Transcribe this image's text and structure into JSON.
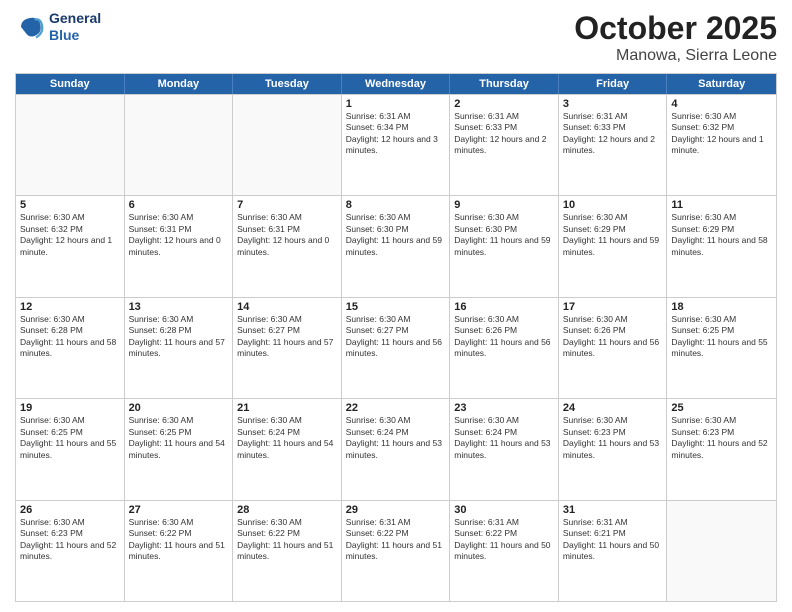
{
  "header": {
    "logo_line1": "General",
    "logo_line2": "Blue",
    "month": "October 2025",
    "location": "Manowa, Sierra Leone"
  },
  "weekdays": [
    "Sunday",
    "Monday",
    "Tuesday",
    "Wednesday",
    "Thursday",
    "Friday",
    "Saturday"
  ],
  "rows": [
    [
      {
        "day": "",
        "info": ""
      },
      {
        "day": "",
        "info": ""
      },
      {
        "day": "",
        "info": ""
      },
      {
        "day": "1",
        "info": "Sunrise: 6:31 AM\nSunset: 6:34 PM\nDaylight: 12 hours and 3 minutes."
      },
      {
        "day": "2",
        "info": "Sunrise: 6:31 AM\nSunset: 6:33 PM\nDaylight: 12 hours and 2 minutes."
      },
      {
        "day": "3",
        "info": "Sunrise: 6:31 AM\nSunset: 6:33 PM\nDaylight: 12 hours and 2 minutes."
      },
      {
        "day": "4",
        "info": "Sunrise: 6:30 AM\nSunset: 6:32 PM\nDaylight: 12 hours and 1 minute."
      }
    ],
    [
      {
        "day": "5",
        "info": "Sunrise: 6:30 AM\nSunset: 6:32 PM\nDaylight: 12 hours and 1 minute."
      },
      {
        "day": "6",
        "info": "Sunrise: 6:30 AM\nSunset: 6:31 PM\nDaylight: 12 hours and 0 minutes."
      },
      {
        "day": "7",
        "info": "Sunrise: 6:30 AM\nSunset: 6:31 PM\nDaylight: 12 hours and 0 minutes."
      },
      {
        "day": "8",
        "info": "Sunrise: 6:30 AM\nSunset: 6:30 PM\nDaylight: 11 hours and 59 minutes."
      },
      {
        "day": "9",
        "info": "Sunrise: 6:30 AM\nSunset: 6:30 PM\nDaylight: 11 hours and 59 minutes."
      },
      {
        "day": "10",
        "info": "Sunrise: 6:30 AM\nSunset: 6:29 PM\nDaylight: 11 hours and 59 minutes."
      },
      {
        "day": "11",
        "info": "Sunrise: 6:30 AM\nSunset: 6:29 PM\nDaylight: 11 hours and 58 minutes."
      }
    ],
    [
      {
        "day": "12",
        "info": "Sunrise: 6:30 AM\nSunset: 6:28 PM\nDaylight: 11 hours and 58 minutes."
      },
      {
        "day": "13",
        "info": "Sunrise: 6:30 AM\nSunset: 6:28 PM\nDaylight: 11 hours and 57 minutes."
      },
      {
        "day": "14",
        "info": "Sunrise: 6:30 AM\nSunset: 6:27 PM\nDaylight: 11 hours and 57 minutes."
      },
      {
        "day": "15",
        "info": "Sunrise: 6:30 AM\nSunset: 6:27 PM\nDaylight: 11 hours and 56 minutes."
      },
      {
        "day": "16",
        "info": "Sunrise: 6:30 AM\nSunset: 6:26 PM\nDaylight: 11 hours and 56 minutes."
      },
      {
        "day": "17",
        "info": "Sunrise: 6:30 AM\nSunset: 6:26 PM\nDaylight: 11 hours and 56 minutes."
      },
      {
        "day": "18",
        "info": "Sunrise: 6:30 AM\nSunset: 6:25 PM\nDaylight: 11 hours and 55 minutes."
      }
    ],
    [
      {
        "day": "19",
        "info": "Sunrise: 6:30 AM\nSunset: 6:25 PM\nDaylight: 11 hours and 55 minutes."
      },
      {
        "day": "20",
        "info": "Sunrise: 6:30 AM\nSunset: 6:25 PM\nDaylight: 11 hours and 54 minutes."
      },
      {
        "day": "21",
        "info": "Sunrise: 6:30 AM\nSunset: 6:24 PM\nDaylight: 11 hours and 54 minutes."
      },
      {
        "day": "22",
        "info": "Sunrise: 6:30 AM\nSunset: 6:24 PM\nDaylight: 11 hours and 53 minutes."
      },
      {
        "day": "23",
        "info": "Sunrise: 6:30 AM\nSunset: 6:24 PM\nDaylight: 11 hours and 53 minutes."
      },
      {
        "day": "24",
        "info": "Sunrise: 6:30 AM\nSunset: 6:23 PM\nDaylight: 11 hours and 53 minutes."
      },
      {
        "day": "25",
        "info": "Sunrise: 6:30 AM\nSunset: 6:23 PM\nDaylight: 11 hours and 52 minutes."
      }
    ],
    [
      {
        "day": "26",
        "info": "Sunrise: 6:30 AM\nSunset: 6:23 PM\nDaylight: 11 hours and 52 minutes."
      },
      {
        "day": "27",
        "info": "Sunrise: 6:30 AM\nSunset: 6:22 PM\nDaylight: 11 hours and 51 minutes."
      },
      {
        "day": "28",
        "info": "Sunrise: 6:30 AM\nSunset: 6:22 PM\nDaylight: 11 hours and 51 minutes."
      },
      {
        "day": "29",
        "info": "Sunrise: 6:31 AM\nSunset: 6:22 PM\nDaylight: 11 hours and 51 minutes."
      },
      {
        "day": "30",
        "info": "Sunrise: 6:31 AM\nSunset: 6:22 PM\nDaylight: 11 hours and 50 minutes."
      },
      {
        "day": "31",
        "info": "Sunrise: 6:31 AM\nSunset: 6:21 PM\nDaylight: 11 hours and 50 minutes."
      },
      {
        "day": "",
        "info": ""
      }
    ]
  ]
}
